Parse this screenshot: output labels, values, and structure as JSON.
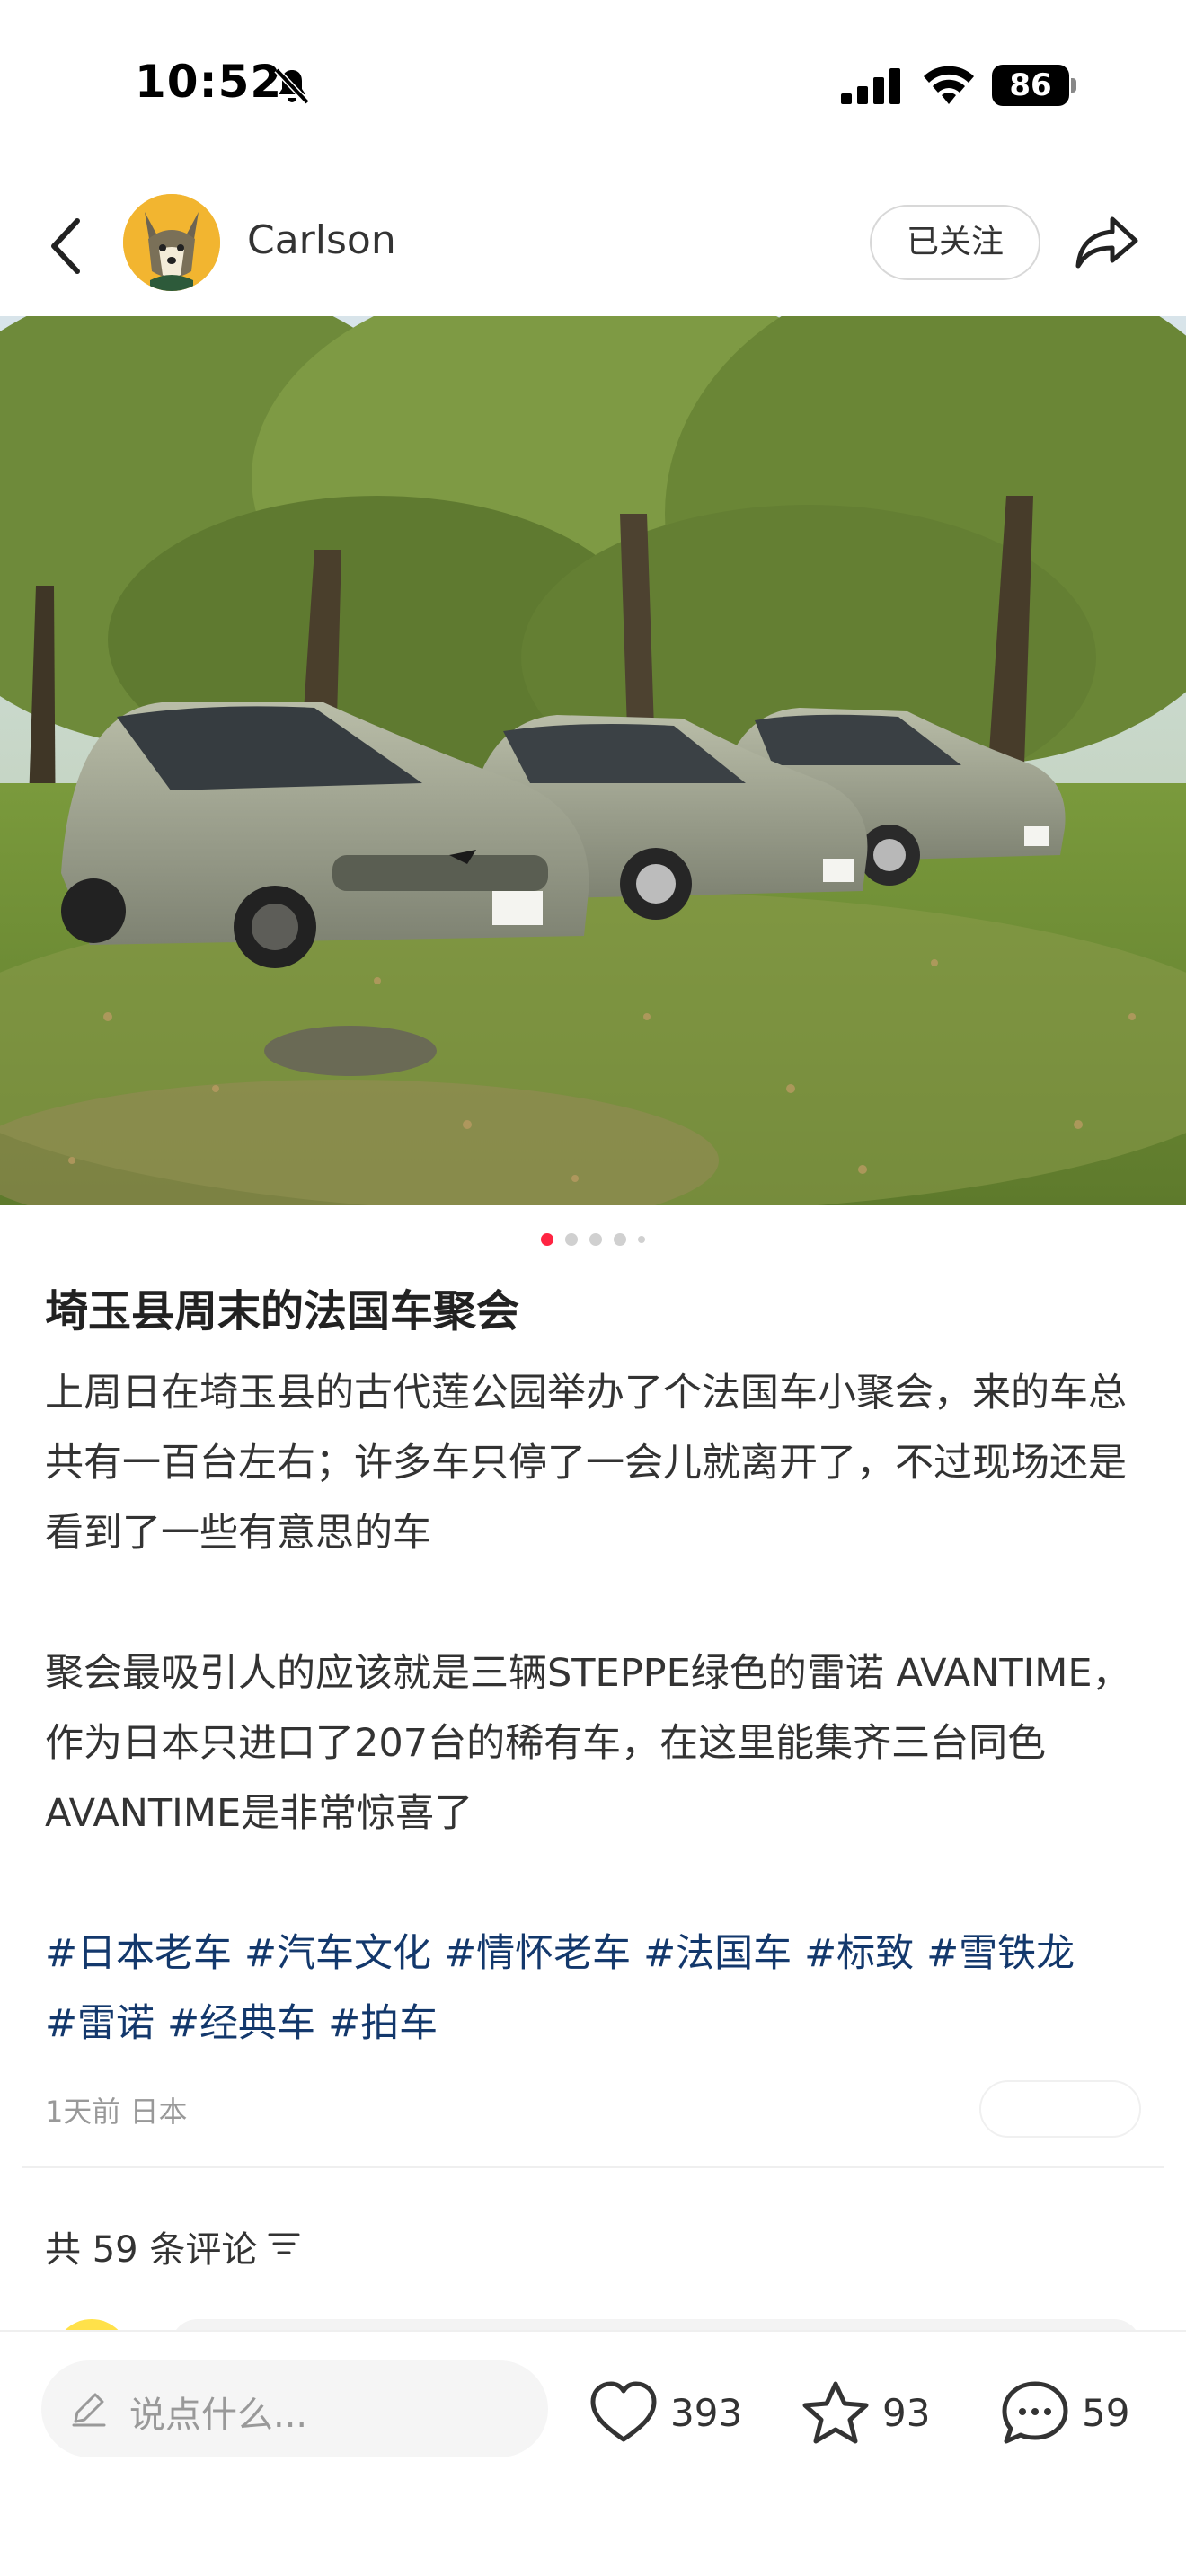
{
  "status_bar": {
    "time": "10:52",
    "battery": "86"
  },
  "header": {
    "author_name": "Carlson",
    "follow_label": "已关注"
  },
  "gallery": {
    "total": 5,
    "active_index": 0
  },
  "post": {
    "title": "埼玉县周末的法国车聚会",
    "paragraphs": [
      "上周日在埼玉县的古代莲公园举办了个法国车小聚会，来的车总共有一百台左右；许多车只停了一会儿就离开了，不过现场还是看到了一些有意思的车",
      "聚会最吸引人的应该就是三辆STEPPE绿色的雷诺 AVANTIME，作为日本只进口了207台的稀有车，在这里能集齐三台同色 AVANTIME是非常惊喜了"
    ],
    "tags": [
      "#日本老车",
      "#汽车文化",
      "#情怀老车",
      "#法国车",
      "#标致",
      "#雪铁龙",
      "#雷诺",
      "#经典车",
      "#拍车"
    ],
    "time": "1天前",
    "location": "日本"
  },
  "comments": {
    "count_label": "共 59 条评论"
  },
  "bottom_bar": {
    "input_placeholder": "说点什么...",
    "likes": "393",
    "favorites": "93",
    "comments": "59"
  },
  "colors": {
    "accent": "#ff2442",
    "tag": "#13386c"
  }
}
